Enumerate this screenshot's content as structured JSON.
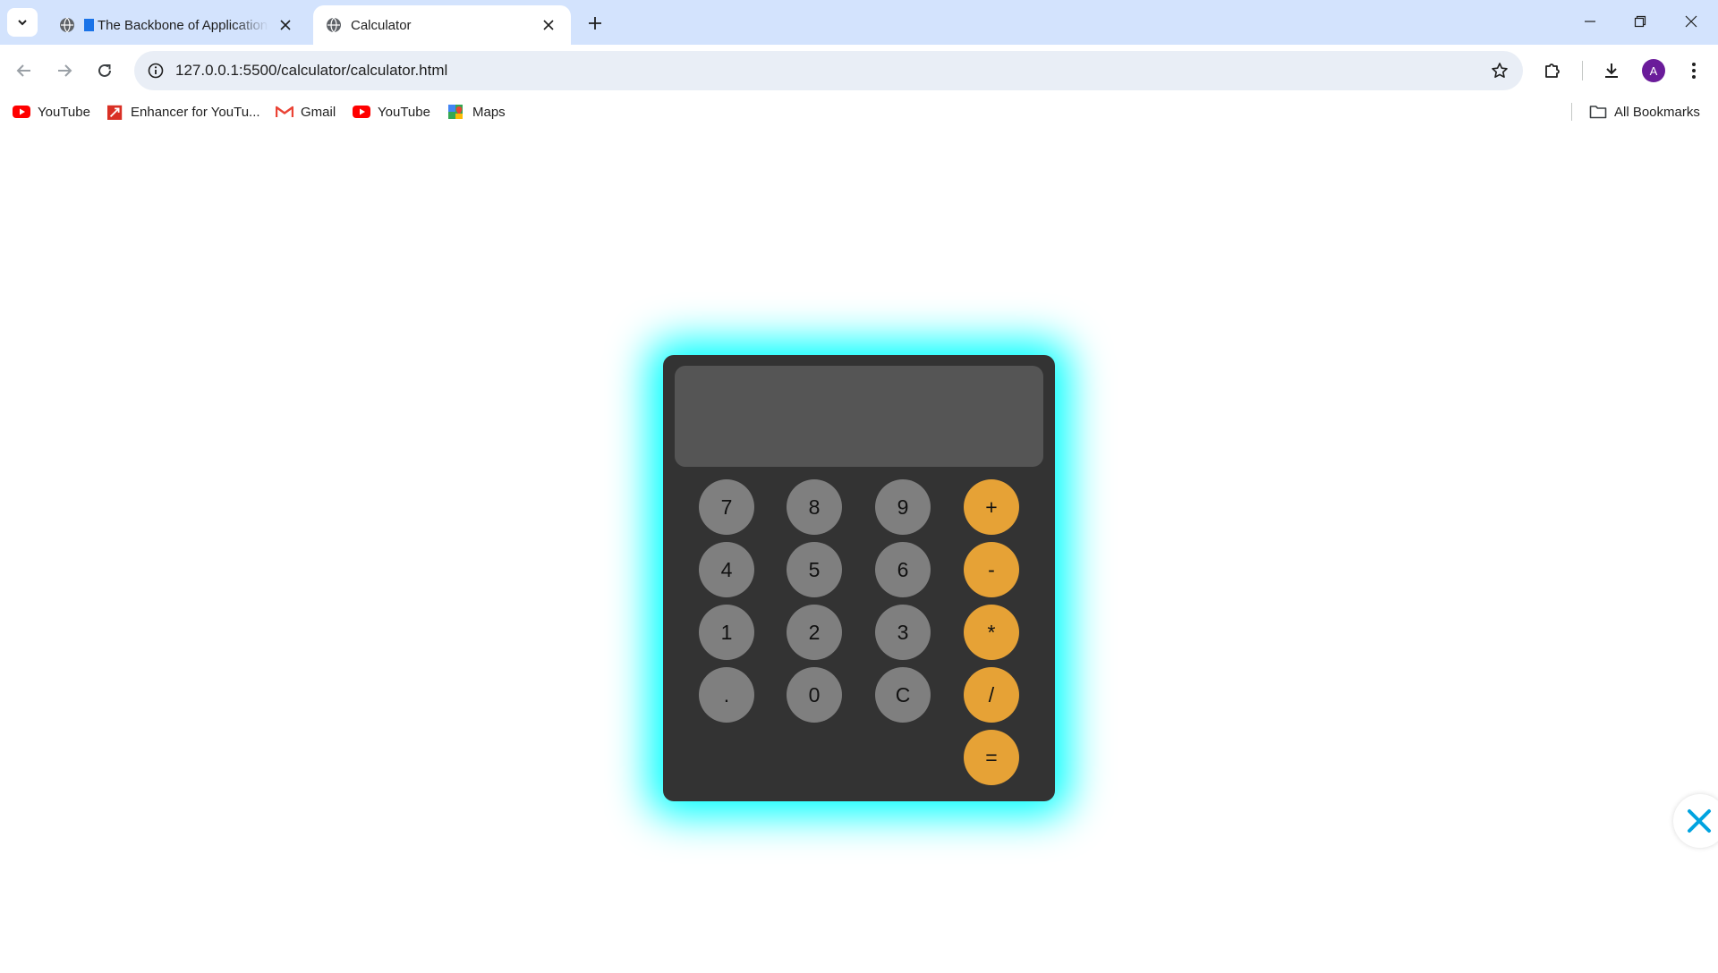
{
  "browser": {
    "tabs": [
      {
        "title": "The Backbone of Application",
        "active": false,
        "favicon": "globe-icon"
      },
      {
        "title": "Calculator",
        "active": true,
        "favicon": "globe-icon"
      }
    ],
    "url": "127.0.0.1:5500/calculator/calculator.html",
    "profile_initial": "A",
    "bookmarks": [
      {
        "label": "YouTube",
        "icon": "youtube-icon"
      },
      {
        "label": "Enhancer for YouTu...",
        "icon": "enhancer-icon"
      },
      {
        "label": "Gmail",
        "icon": "gmail-icon"
      },
      {
        "label": "YouTube",
        "icon": "youtube-icon"
      },
      {
        "label": "Maps",
        "icon": "maps-icon"
      }
    ],
    "all_bookmarks_label": "All Bookmarks"
  },
  "calculator": {
    "display_value": "",
    "keys": {
      "k7": "7",
      "k8": "8",
      "k9": "9",
      "plus": "+",
      "k4": "4",
      "k5": "5",
      "k6": "6",
      "minus": "-",
      "k1": "1",
      "k2": "2",
      "k3": "3",
      "multiply": "*",
      "dot": ".",
      "k0": "0",
      "clear": "C",
      "divide": "/",
      "equals": "="
    },
    "colors": {
      "body": "#333333",
      "display": "#555555",
      "number_key": "#7f7f7f",
      "operator_key": "#e6a236",
      "glow": "#00ffff"
    }
  }
}
